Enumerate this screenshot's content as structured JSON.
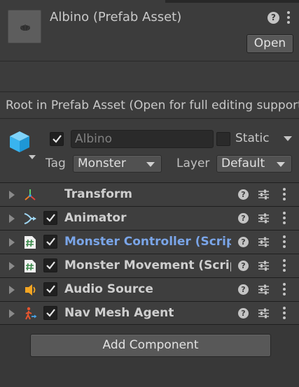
{
  "header": {
    "title": "Albino (Prefab Asset)",
    "help_glyph": "?",
    "open_label": "Open"
  },
  "info": {
    "message": "Root in Prefab Asset (Open for full editing support)"
  },
  "gameobject": {
    "active": true,
    "name": "Albino",
    "static_label": "Static",
    "static_checked": false,
    "tag_label": "Tag",
    "tag_value": "Monster",
    "layer_label": "Layer",
    "layer_value": "Default"
  },
  "components": [
    {
      "name": "Transform",
      "icon": "transform-icon",
      "has_checkbox": false,
      "enabled": null
    },
    {
      "name": "Animator",
      "icon": "animator-icon",
      "has_checkbox": true,
      "enabled": true
    },
    {
      "name": "Monster Controller (Script)",
      "icon": "script-icon",
      "has_checkbox": true,
      "enabled": true,
      "accent": true
    },
    {
      "name": "Monster Movement (Script)",
      "icon": "script-icon",
      "has_checkbox": true,
      "enabled": true
    },
    {
      "name": "Audio Source",
      "icon": "audio-source-icon",
      "has_checkbox": true,
      "enabled": true
    },
    {
      "name": "Nav Mesh Agent",
      "icon": "nav-mesh-agent-icon",
      "has_checkbox": true,
      "enabled": true
    }
  ],
  "add_component_label": "Add Component",
  "colors": {
    "background": "#383838",
    "panel": "#3c3c3c",
    "accent_text": "#7aa5e8",
    "cube_icon": "#3fb8f2"
  }
}
